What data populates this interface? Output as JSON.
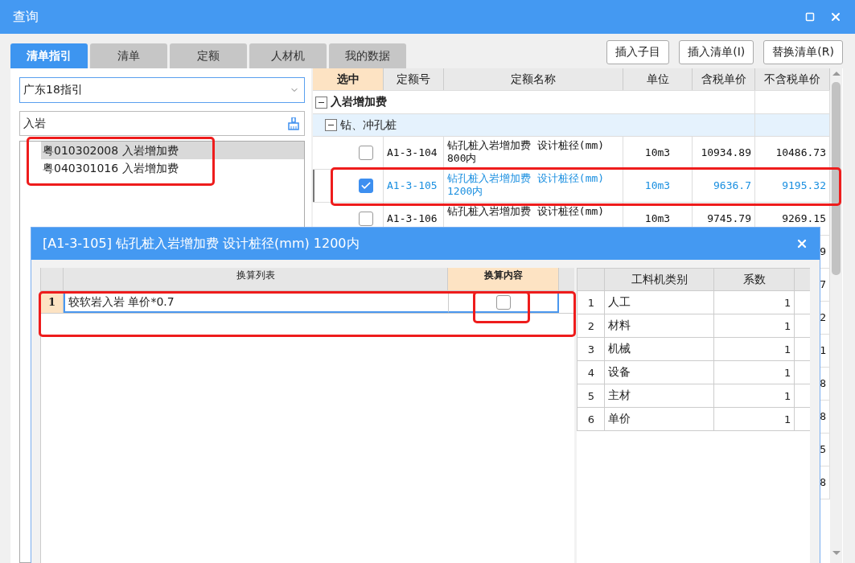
{
  "window": {
    "title": "查询"
  },
  "tabs": [
    {
      "label": "清单指引",
      "selected": true
    },
    {
      "label": "清单",
      "selected": false
    },
    {
      "label": "定额",
      "selected": false
    },
    {
      "label": "人材机",
      "selected": false
    },
    {
      "label": "我的数据",
      "selected": false
    }
  ],
  "actions": [
    "插入子目",
    "插入清单(I)",
    "替换清单(R)"
  ],
  "guide": {
    "dropdown": "广东18指引",
    "search": "入岩",
    "items": [
      {
        "label": "粤010302008  入岩增加费",
        "selected": true
      },
      {
        "label": "粤040301016  入岩增加费",
        "selected": false
      }
    ]
  },
  "table": {
    "columns": [
      "选中",
      "定额号",
      "定额名称",
      "单位",
      "含税单价",
      "不含税单价"
    ],
    "rows": [
      {
        "kind": "group",
        "label": "入岩增加费",
        "expanded": true
      },
      {
        "kind": "subgroup",
        "label": "钻、冲孔桩",
        "expanded": true
      },
      {
        "kind": "item",
        "checked": false,
        "selected": false,
        "code": "A1-3-104",
        "name": "钻孔桩入岩增加费 设计桩径(mm) 800内",
        "unit": "10m3",
        "price_tax": "10934.89",
        "price_notax": "10486.73"
      },
      {
        "kind": "item",
        "checked": true,
        "selected": true,
        "code": "A1-3-105",
        "name": "钻孔桩入岩增加费 设计桩径(mm) 1200内",
        "unit": "10m3",
        "price_tax": "9636.7",
        "price_notax": "9195.32"
      },
      {
        "kind": "item",
        "checked": false,
        "selected": false,
        "code": "A1-3-106",
        "name": "钻孔桩入岩增加费 设计桩径(mm)",
        "unit": "10m3",
        "price_tax": "9745.79",
        "price_notax": "9269.15"
      },
      {
        "kind": "fragment",
        "text": "9"
      },
      {
        "kind": "fragment",
        "text": "7"
      },
      {
        "kind": "fragment",
        "text": "2"
      },
      {
        "kind": "fragment",
        "text": "1"
      },
      {
        "kind": "fragment",
        "text": "8"
      },
      {
        "kind": "fragment",
        "text": "8"
      },
      {
        "kind": "fragment",
        "text": "5"
      },
      {
        "kind": "fragment",
        "text": "8"
      }
    ]
  },
  "dialog": {
    "title": "[A1-3-105] 钻孔桩入岩增加费 设计桩径(mm) 1200内",
    "conversion": {
      "columns": [
        "换算列表",
        "换算内容"
      ],
      "rows": [
        {
          "index": "1",
          "text": "较软岩入岩 单价*0.7",
          "checked": false
        }
      ]
    },
    "factors": {
      "columns": [
        "工料机类别",
        "系数"
      ],
      "rows": [
        {
          "index": "1",
          "category": "人工",
          "value": "1"
        },
        {
          "index": "2",
          "category": "材料",
          "value": "1"
        },
        {
          "index": "3",
          "category": "机械",
          "value": "1"
        },
        {
          "index": "4",
          "category": "设备",
          "value": "1"
        },
        {
          "index": "5",
          "category": "主材",
          "value": "1"
        },
        {
          "index": "6",
          "category": "单价",
          "value": "1"
        }
      ]
    }
  }
}
